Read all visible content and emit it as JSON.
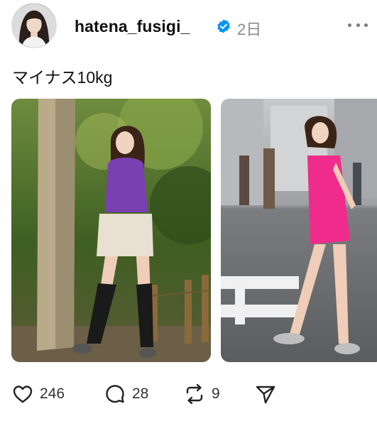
{
  "post": {
    "username": "hatena_fusigi_",
    "time": "2日",
    "caption": "マイナス10kg",
    "verified": true
  },
  "media": [
    {
      "alt": "Woman in purple blouse, pleated mini skirt and black knee socks standing beside a tree in a park"
    },
    {
      "alt": "Woman in pink mini dress standing on a city street crosswalk"
    }
  ],
  "actions": {
    "likes": "246",
    "replies": "28",
    "reposts": "9"
  },
  "icons": {
    "avatar": "profile-photo",
    "verified": "verified-badge-icon",
    "more": "more-horizontal-icon",
    "like": "heart-icon",
    "reply": "comment-icon",
    "repost": "repost-icon",
    "share": "send-icon"
  },
  "colors": {
    "verified": "#0095f6",
    "secondary_text": "#8a8a8a"
  }
}
